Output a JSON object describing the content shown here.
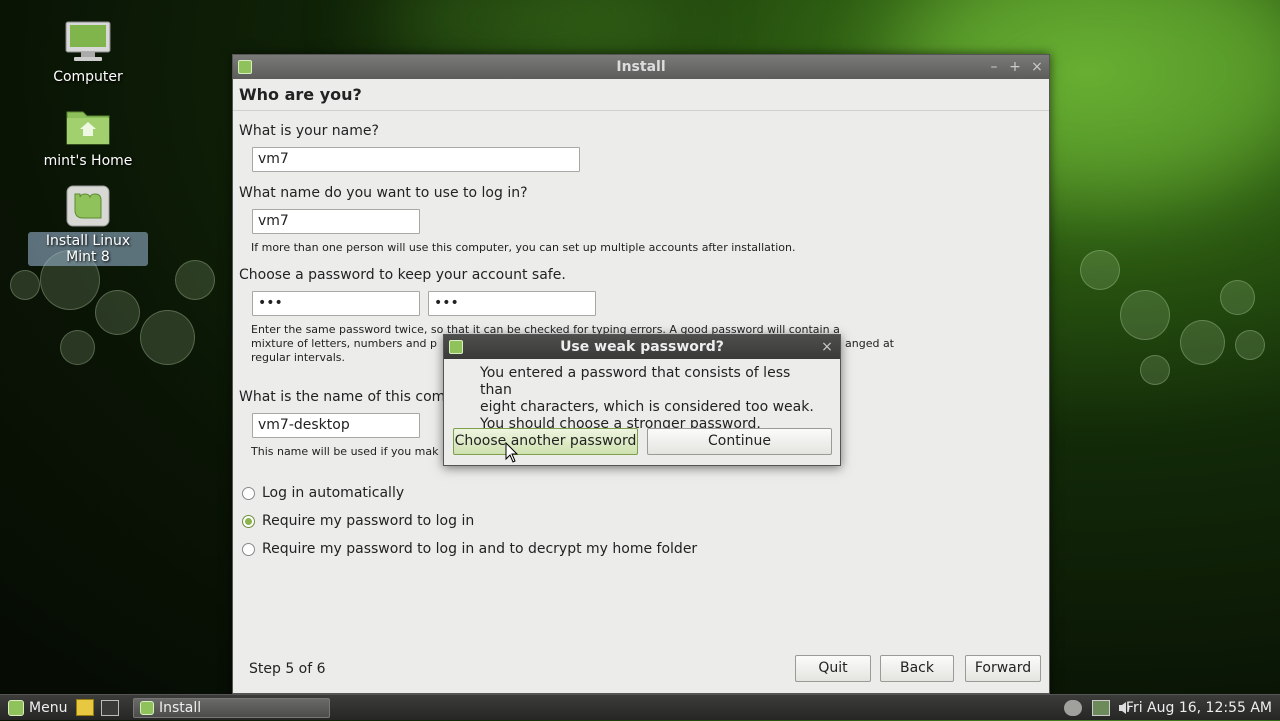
{
  "desktop": {
    "icons": [
      {
        "label": "Computer"
      },
      {
        "label": "mint's Home"
      },
      {
        "label": "Install Linux Mint 8"
      }
    ]
  },
  "window": {
    "title": "Install",
    "controls": {
      "minimize": "–",
      "maximize": "+",
      "close": "×"
    },
    "heading": "Who are you?",
    "name_question": "What is your name?",
    "name_value": "vm7",
    "login_question": "What name do you want to use to log in?",
    "login_value": "vm7",
    "login_hint": "If more than one person will use this computer, you can set up multiple accounts after installation.",
    "password_question": "Choose a password to keep your account safe.",
    "password_value": "•••",
    "password_confirm_value": "•••",
    "password_hint_line1": "Enter the same password twice, so that it can be checked for typing errors. A good password will contain a",
    "password_hint_line2_left": "mixture of letters, numbers and p",
    "password_hint_line2_right": "anged at",
    "password_hint_line3": "regular intervals.",
    "computer_question": "What is the name of this compu",
    "computer_value": "vm7-desktop",
    "computer_hint": "This name will be used if you mak",
    "login_options": [
      {
        "label": "Log in automatically",
        "selected": false
      },
      {
        "label": "Require my password to log in",
        "selected": true
      },
      {
        "label": "Require my password to log in and to decrypt my home folder",
        "selected": false
      }
    ],
    "step": "Step 5 of 6",
    "quit_label": "Quit",
    "back_label": "Back",
    "forward_label": "Forward"
  },
  "dialog": {
    "title": "Use weak password?",
    "close": "×",
    "message_line1": "You entered a password that consists of less than",
    "message_line2": "eight characters, which is considered too weak.",
    "message_line3": "You should choose a stronger password.",
    "choose_label": "Choose another password",
    "continue_label": "Continue"
  },
  "taskbar": {
    "menu_label": "Menu",
    "task_label": "Install",
    "clock": "Fri Aug 16, 12:55 AM"
  },
  "colors": {
    "accent": "#8fc25b",
    "desktop_bg": "#0a1405"
  }
}
